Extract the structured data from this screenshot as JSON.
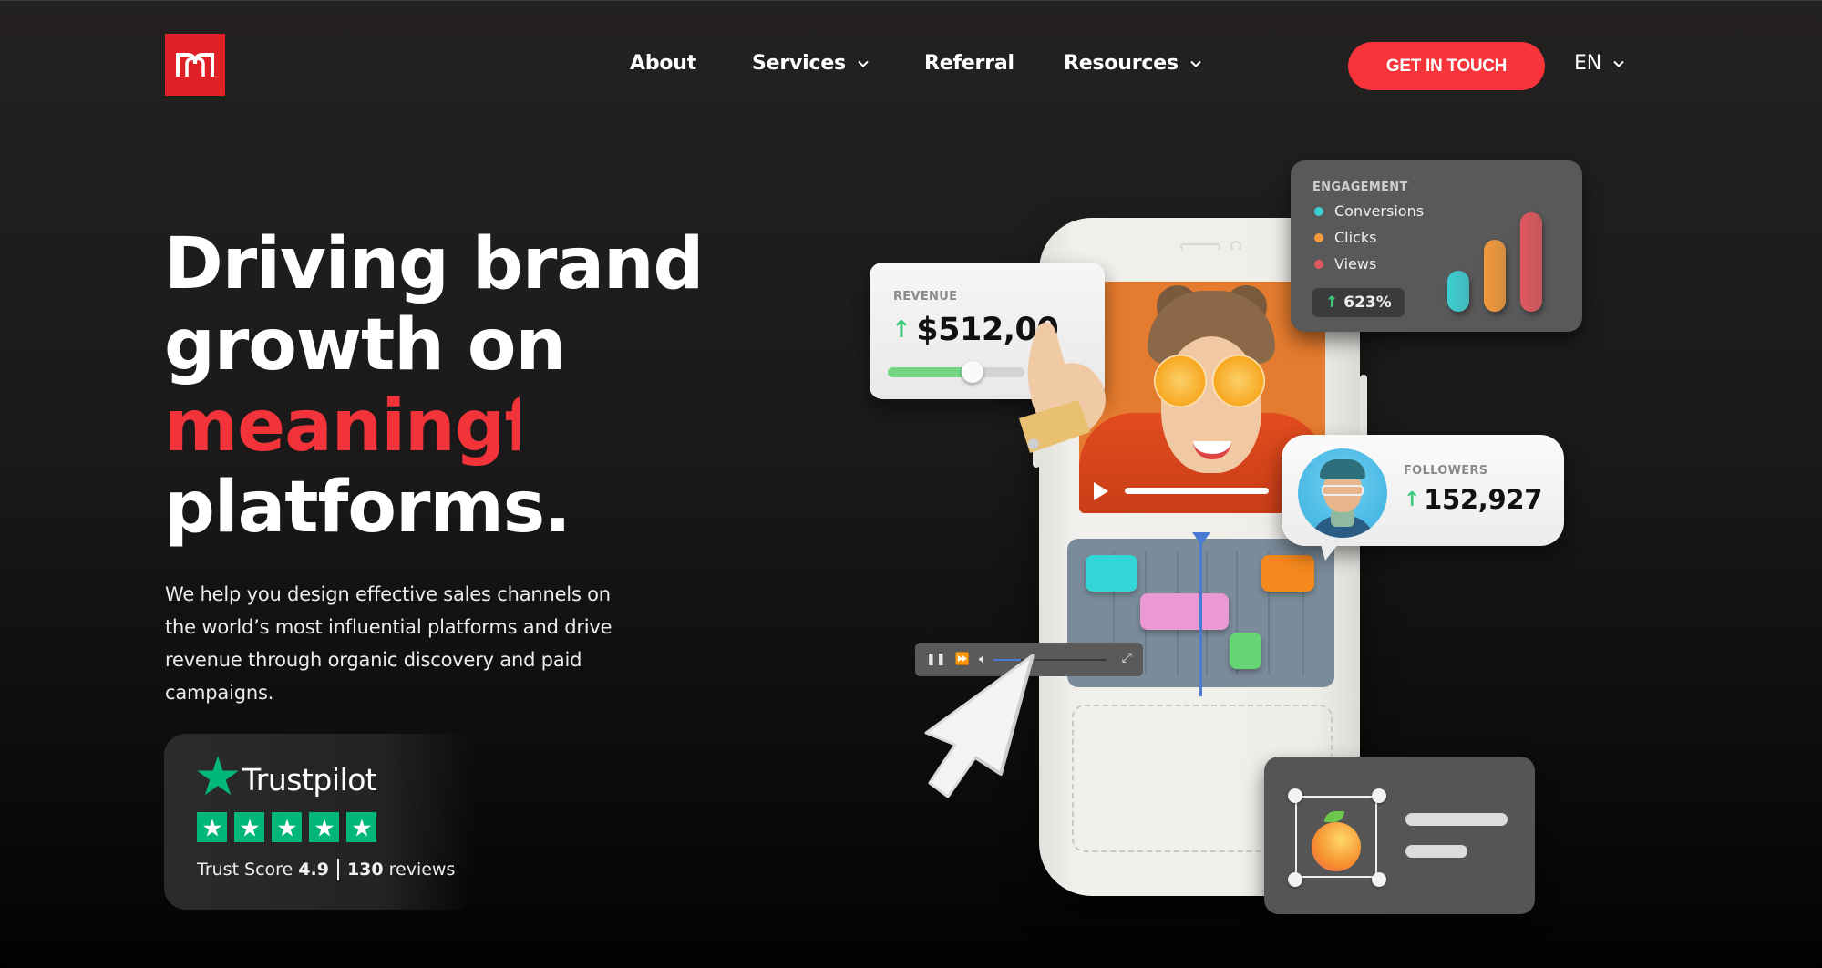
{
  "brand": {
    "logo_icon": "m-arch-logo-icon",
    "accent_color": "#f3333a",
    "logo_color": "#e02027"
  },
  "nav": {
    "items": [
      {
        "label": "About",
        "has_dropdown": false
      },
      {
        "label": "Services",
        "has_dropdown": true
      },
      {
        "label": "Referral",
        "has_dropdown": false
      },
      {
        "label": "Resources",
        "has_dropdown": true
      }
    ],
    "cta_label": "GET IN TOUCH",
    "language": "EN"
  },
  "hero": {
    "headline_lines": [
      "Driving brand",
      "growth on",
      "meaningful",
      "platforms."
    ],
    "highlighted_line_index": 2,
    "subtext": "We help you design effective sales channels on the world’s most influential platforms and drive revenue through organic discovery and paid campaigns."
  },
  "trustpilot": {
    "brand": "Trustpilot",
    "stars": 5,
    "score_label": "Trust Score",
    "score": "4.9",
    "reviews_count": "130",
    "reviews_label": "reviews",
    "brand_color": "#00b67a"
  },
  "illustration": {
    "revenue_card": {
      "label": "REVENUE",
      "value": "$512,00",
      "trend": "up",
      "slider_fraction": 0.62
    },
    "engagement_card": {
      "label": "ENGAGEMENT",
      "legend": [
        {
          "name": "Conversions",
          "color": "#3ccfd2",
          "relative_value": 0.33
        },
        {
          "name": "Clicks",
          "color": "#f39a3a",
          "relative_value": 0.58
        },
        {
          "name": "Views",
          "color": "#e0585e",
          "relative_value": 0.8
        }
      ],
      "change": "623%",
      "trend": "up"
    },
    "followers_card": {
      "label": "FOLLOWERS",
      "value": "152,927",
      "trend": "up"
    },
    "video_player": {
      "controls": [
        "pause-icon",
        "fast-forward-icon",
        "volume-icon",
        "fullscreen-icon"
      ],
      "progress_fraction": 0.24
    },
    "timeline_blocks": [
      {
        "color": "#33d6d6"
      },
      {
        "color": "#ea98d6"
      },
      {
        "color": "#66d674"
      },
      {
        "color": "#f6891e"
      }
    ]
  }
}
